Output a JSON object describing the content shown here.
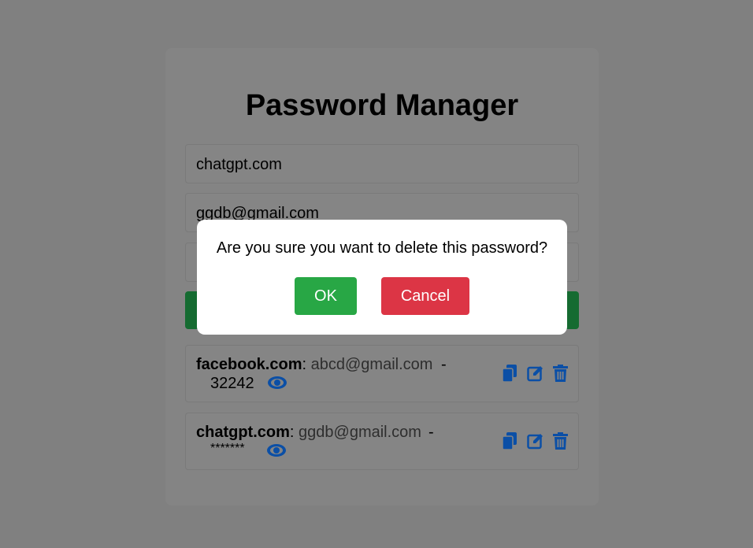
{
  "app": {
    "title": "Password Manager"
  },
  "form": {
    "website_value": "chatgpt.com",
    "username_value": "ggdb@gmail.com"
  },
  "entries": [
    {
      "site": "facebook.com",
      "email": "abcd@gmail.com",
      "password": "32242"
    },
    {
      "site": "chatgpt.com",
      "email": "ggdb@gmail.com",
      "password": "*******"
    }
  ],
  "separators": {
    "colon": ": ",
    "dash": "-"
  },
  "icons": {
    "show": "eye-icon",
    "copy": "copy-icon",
    "edit": "edit-icon",
    "delete": "trash-icon"
  },
  "dialog": {
    "message": "Are you sure you want to delete this password?",
    "ok_label": "OK",
    "cancel_label": "Cancel"
  },
  "colors": {
    "overlay": "#808080",
    "icon": "#0b4fa6",
    "ok": "#28a745",
    "cancel": "#dc3545",
    "add_button": "#156b31"
  }
}
